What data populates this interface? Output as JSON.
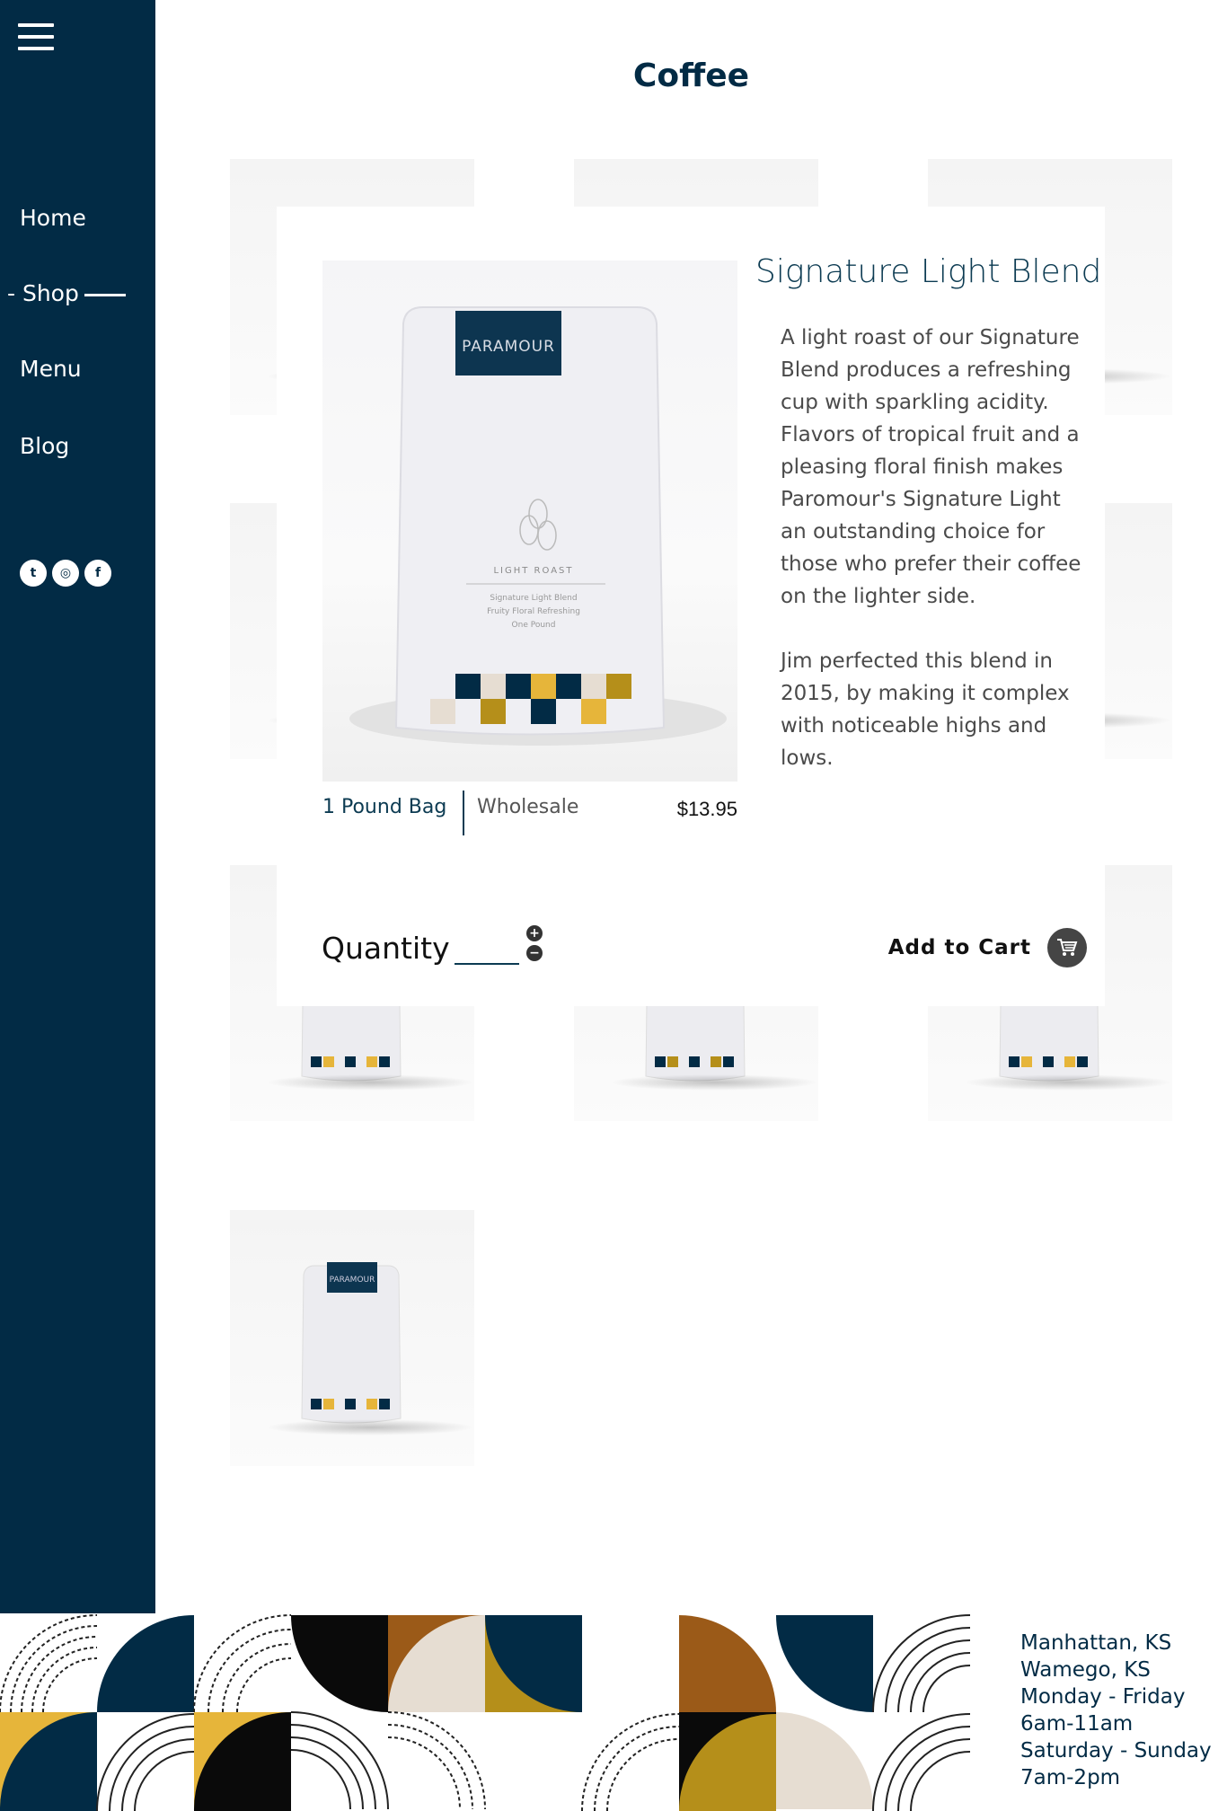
{
  "colors": {
    "navy": "#022b45",
    "gold": "#b58f1a",
    "yellow": "#e6b53a",
    "brown": "#9b5a18",
    "beige": "#e6ddd2"
  },
  "sidebar": {
    "menu_icon": "hamburger-icon",
    "nav": [
      {
        "label": "Home"
      },
      {
        "label": "- Shop"
      },
      {
        "label": "Menu"
      },
      {
        "label": "Blog"
      }
    ],
    "social": [
      {
        "icon": "twitter-icon",
        "glyph": "t"
      },
      {
        "icon": "instagram-icon",
        "glyph": "◎"
      },
      {
        "icon": "facebook-icon",
        "glyph": "f"
      }
    ]
  },
  "main": {
    "title": "Coffee"
  },
  "product_bag": {
    "brand": "PARAMOUR",
    "roast": "LIGHT ROAST",
    "lines": [
      "Signature Light Blend",
      "Fruity Floral Refreshing",
      "One Pound"
    ]
  },
  "modal": {
    "title": "Signature Light Blend",
    "description": [
      "A light roast of our Signature Blend produces a refreshing cup with sparkling acidity. Flavors of tropical fruit and a pleasing floral finish makes Paromour's Signature Light an outstanding choice for those who prefer their coffee on the lighter side.",
      "Jim perfected this blend in 2015, by making it complex with noticeable highs and lows."
    ],
    "option_selected": "1 Pound Bag",
    "option_other": "Wholesale",
    "price": "$13.95",
    "quantity_label": "Quantity",
    "quantity_value": "",
    "plus": "+",
    "minus": "−",
    "add_to_cart": "Add to Cart"
  },
  "footer": {
    "hours": [
      "Manhattan, KS",
      "Wamego, KS",
      "Monday - Friday",
      "6am-11am",
      "Saturday - Sunday",
      "7am-2pm"
    ]
  }
}
